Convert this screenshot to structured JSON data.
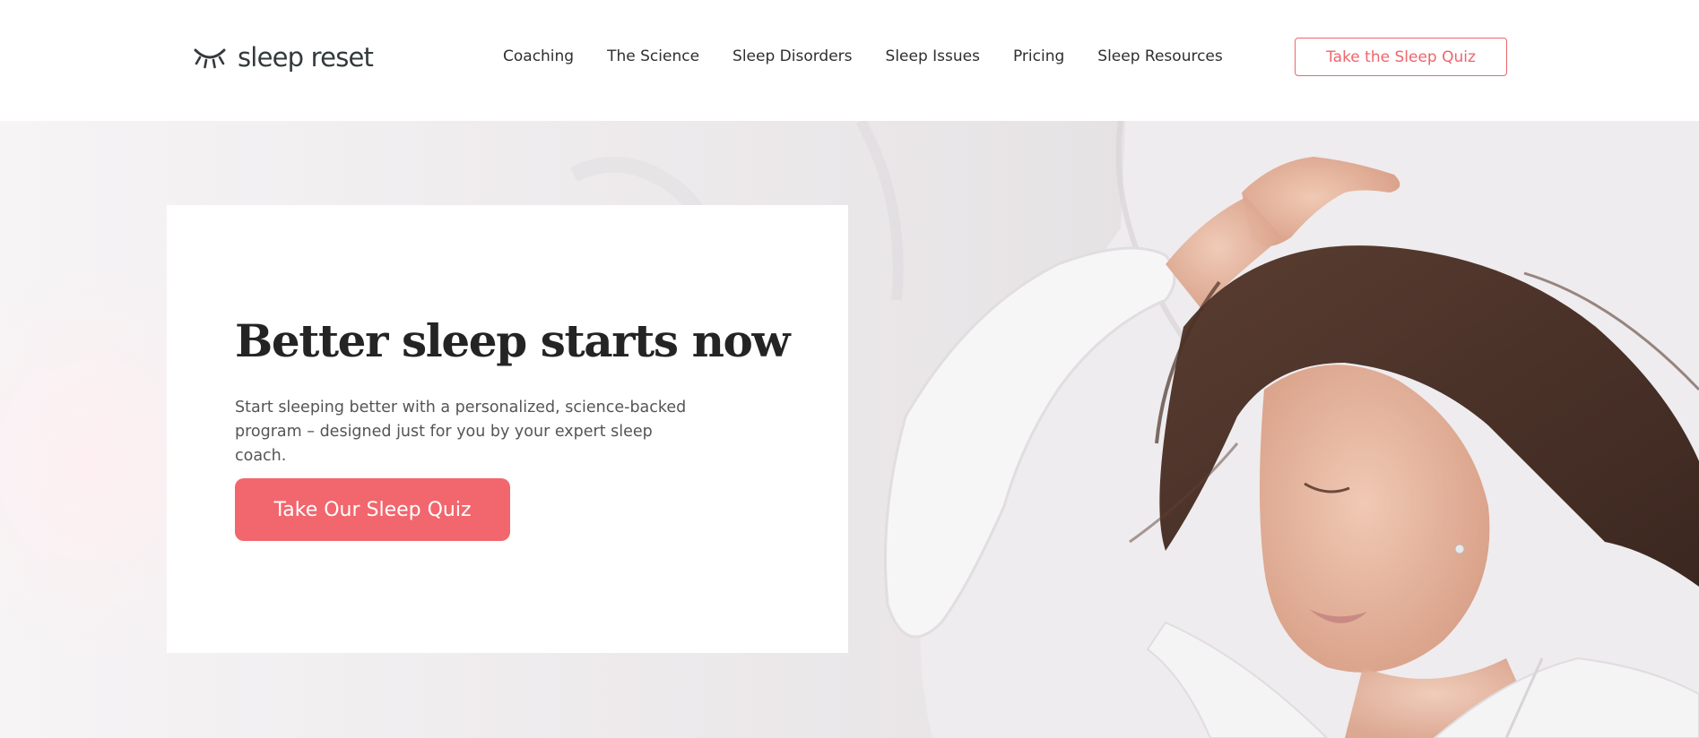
{
  "brand": {
    "name": "sleep reset",
    "logo_icon": "closed-eye-icon",
    "accent_color": "#F2666D"
  },
  "nav": {
    "items": [
      {
        "label": "Coaching"
      },
      {
        "label": "The Science"
      },
      {
        "label": "Sleep Disorders"
      },
      {
        "label": "Sleep Issues"
      },
      {
        "label": "Pricing"
      },
      {
        "label": "Sleep Resources"
      }
    ],
    "cta_label": "Take the Sleep Quiz"
  },
  "hero": {
    "title": "Better sleep starts now",
    "subtitle": "Start sleeping better with a personalized, science-backed program – designed just for you by your expert sleep coach.",
    "cta_label": "Take Our Sleep Quiz",
    "image": "woman-sleeping-in-white-bed-photo"
  }
}
